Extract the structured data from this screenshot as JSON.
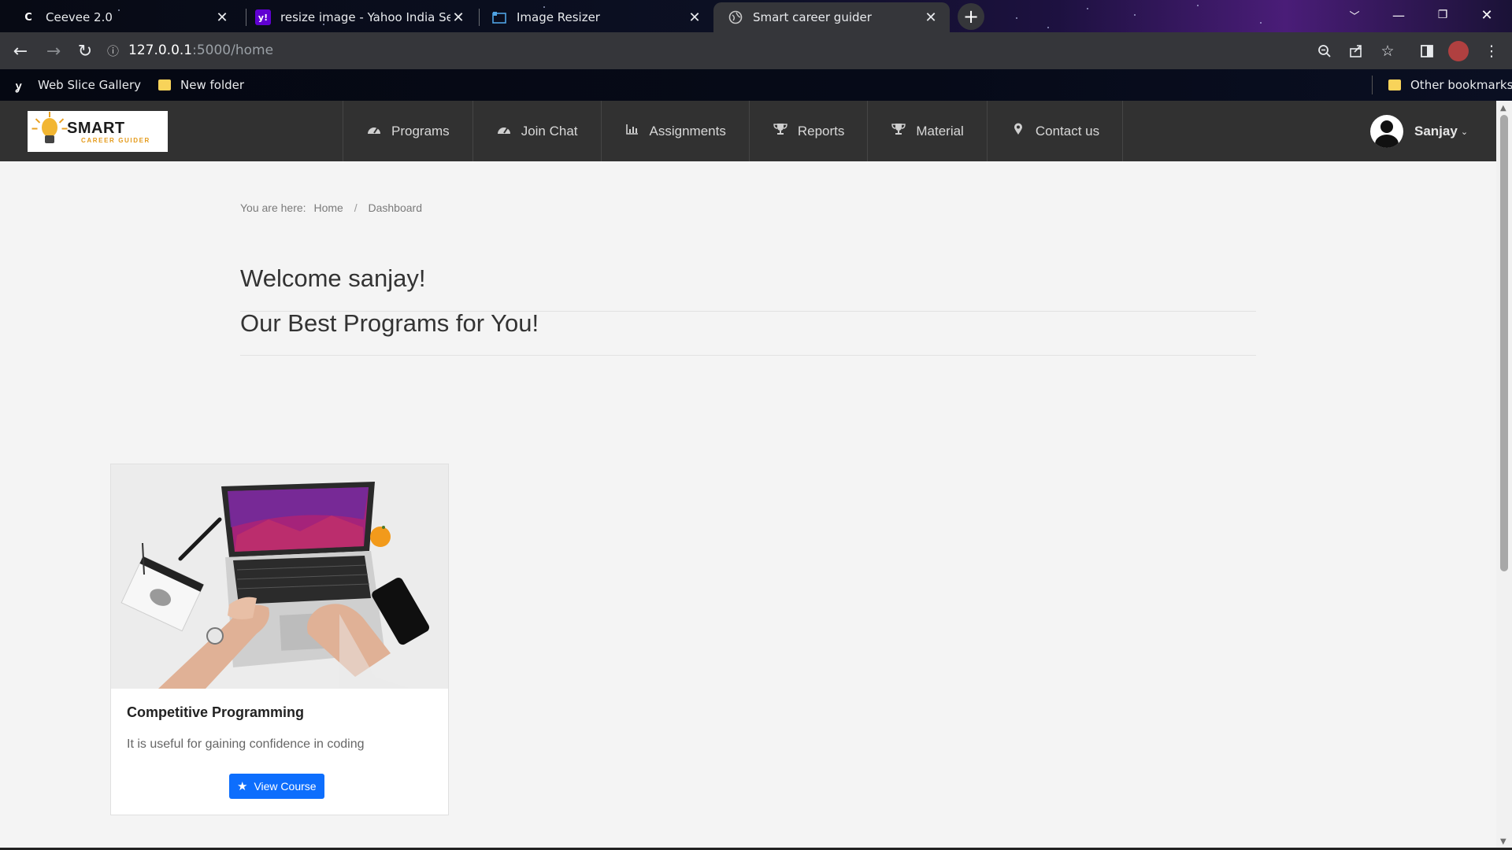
{
  "browser": {
    "tabs": [
      {
        "title": "Ceevee 2.0",
        "favicon": "C"
      },
      {
        "title": "resize image - Yahoo India Search",
        "favicon": "y!"
      },
      {
        "title": "Image Resizer",
        "favicon": "image-resizer-icon"
      },
      {
        "title": "Smart career guider",
        "favicon": "globe-icon",
        "active": true
      }
    ],
    "url_host": "127.0.0.1",
    "url_path": ":5000/home",
    "bookmarks": [
      "Web Slice Gallery",
      "New folder"
    ],
    "other_bookmarks": "Other bookmarks"
  },
  "site": {
    "logo_main": "SMART",
    "logo_sub": "CAREER GUIDER",
    "menu": [
      {
        "label": "Programs",
        "icon": "dashboard-icon"
      },
      {
        "label": "Join Chat",
        "icon": "dashboard-icon"
      },
      {
        "label": "Assignments",
        "icon": "bar-chart-icon"
      },
      {
        "label": "Reports",
        "icon": "trophy-icon"
      },
      {
        "label": "Material",
        "icon": "trophy-icon"
      },
      {
        "label": "Contact us",
        "icon": "map-pin-icon"
      }
    ],
    "user_name": "Sanjay"
  },
  "breadcrumb": {
    "prefix": "You are here:",
    "home": "Home",
    "separator": "/",
    "current": "Dashboard"
  },
  "welcome": "Welcome sanjay!",
  "programs_heading": "Our Best Programs for You!",
  "courses": [
    {
      "title": "Competitive Programming",
      "description": "It is useful for gaining confidence in coding",
      "button_label": "View Course"
    }
  ],
  "colors": {
    "nav_bg": "#313131",
    "accent_button": "#0d6efd",
    "logo_accent": "#e49a1a"
  }
}
